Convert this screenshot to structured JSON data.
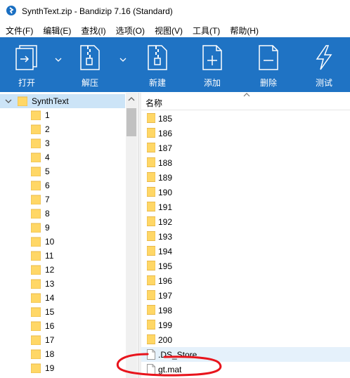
{
  "window": {
    "title": "SynthText.zip - Bandizip 7.16 (Standard)"
  },
  "menu": [
    "文件(F)",
    "编辑(E)",
    "查找(I)",
    "选项(O)",
    "视图(V)",
    "工具(T)",
    "帮助(H)"
  ],
  "toolbar": {
    "open": "打开",
    "extract": "解压",
    "new": "新建",
    "add": "添加",
    "delete": "删除",
    "test": "测试"
  },
  "tree": {
    "root": "SynthText",
    "items": [
      "1",
      "2",
      "3",
      "4",
      "5",
      "6",
      "7",
      "8",
      "9",
      "10",
      "11",
      "12",
      "13",
      "14",
      "15",
      "16",
      "17",
      "18",
      "19"
    ]
  },
  "filelist": {
    "column_name": "名称",
    "folders": [
      "185",
      "186",
      "187",
      "188",
      "189",
      "190",
      "191",
      "192",
      "193",
      "194",
      "195",
      "196",
      "197",
      "198",
      "199",
      "200"
    ],
    "files": [
      ".DS_Store",
      "gt.mat"
    ]
  },
  "colors": {
    "toolbar_bg": "#1f73c4",
    "folder": "#ffd766",
    "selection": "#cce4f7",
    "annotation": "#e8141c"
  }
}
